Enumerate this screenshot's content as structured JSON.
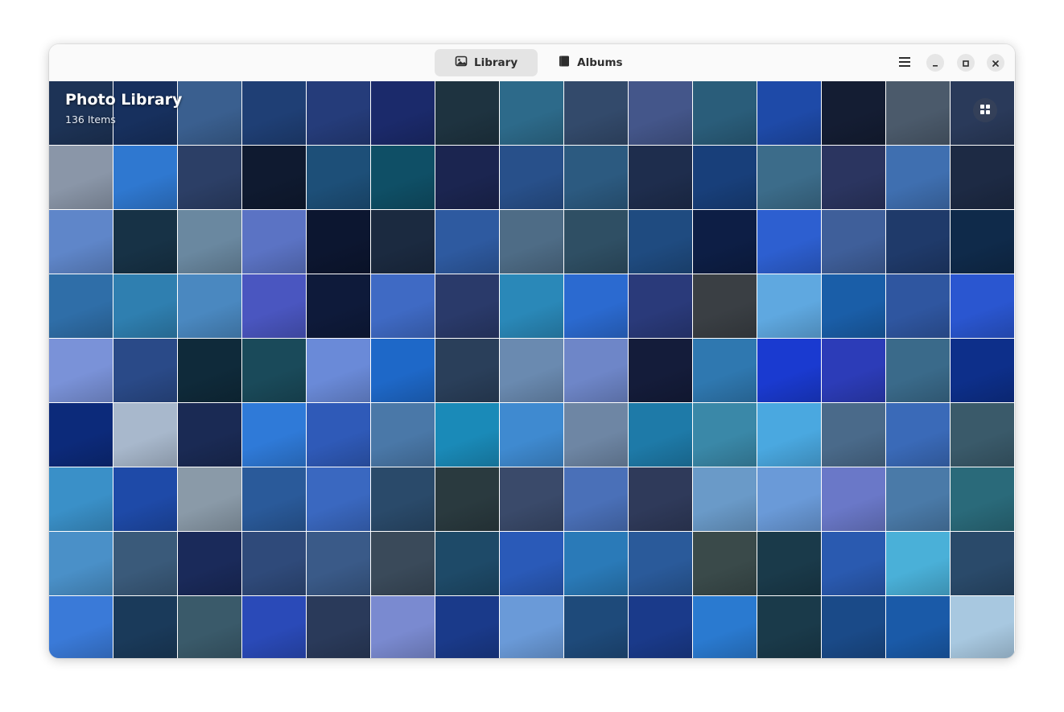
{
  "header": {
    "tabs": [
      {
        "label": "Library",
        "icon": "image-icon",
        "active": true
      },
      {
        "label": "Albums",
        "icon": "album-icon",
        "active": false
      }
    ],
    "menu_icon": "hamburger-menu-icon",
    "window_controls": [
      "minimize-icon",
      "maximize-icon",
      "close-icon"
    ]
  },
  "library": {
    "title": "Photo Library",
    "count": "136 Items",
    "view_toggle_icon": "grid-view-icon"
  },
  "photos": [
    [
      "#1d3356",
      "#17305e",
      "#3a5f8f",
      "#1f3f75",
      "#253c7a",
      "#1b2a6b",
      "#1e3340",
      "#2d6a8a",
      "#334a6b",
      "#44568a",
      "#2a5d7a",
      "#1e4aa8",
      "#141d33",
      "#4b5a6b",
      "#2a3a5a"
    ],
    [
      "#8a96a8",
      "#2f78d0",
      "#2c3f66",
      "#0f1a30",
      "#1d4f78",
      "#0f4f66",
      "#1b2550",
      "#28508a",
      "#2c5a80",
      "#1e2d4d",
      "#183f7a",
      "#3c6c8a",
      "#2b3560",
      "#3f6fb0",
      "#1d2a44"
    ],
    [
      "#5f86c9",
      "#173246",
      "#6a88a0",
      "#5b73c4",
      "#0c1630",
      "#1b2a40",
      "#2e5aa0",
      "#4e6c86",
      "#2f4f64",
      "#1f4b80",
      "#0d1e45",
      "#2d5fd0",
      "#3f5f9a",
      "#1f3a6a",
      "#0f2a4a"
    ],
    [
      "#2f6ea8",
      "#2f7fb0",
      "#4a88c0",
      "#4a56c0",
      "#0e1a3a",
      "#3f6ac4",
      "#2a3a6a",
      "#2a88b8",
      "#2b6ad0",
      "#2a3a7a",
      "#3a3f44",
      "#5fa8e0",
      "#1a5ea8",
      "#2f56a0",
      "#2a56d0"
    ],
    [
      "#7a92d8",
      "#2a4a88",
      "#0f2a3a",
      "#1a4a5a",
      "#6a8ad8",
      "#1e68c8",
      "#2a3f5a",
      "#6a8ab0",
      "#6e86c8",
      "#141c3a",
      "#2f78b0",
      "#1a3ad0",
      "#2c3cb8",
      "#3a6a8a",
      "#0d2f8a"
    ],
    [
      "#0c2a7a",
      "#a8b8cc",
      "#1a2a54",
      "#2f7ad8",
      "#2f5ab8",
      "#4a78a8",
      "#1a8ab8",
      "#3f8ad0",
      "#6e86a4",
      "#1e7aa8",
      "#3a88a8",
      "#4aa8e0",
      "#4a6a8a",
      "#3a6ab8",
      "#3a5a6a"
    ],
    [
      "#3a90c8",
      "#1e4aa8",
      "#8a9aa8",
      "#2a5a9a",
      "#3a68c0",
      "#2a4a6a",
      "#2a3a3f",
      "#3a4a6a",
      "#4a70b8",
      "#2f3a5a",
      "#6a9ac8",
      "#6a9ad8",
      "#6a78c8",
      "#4a7aa8",
      "#2a6a7a"
    ],
    [
      "#4a90c8",
      "#3a5a7a",
      "#1a2a5a",
      "#2f4a7a",
      "#3a5a88",
      "#3a4a5a",
      "#1e4a68",
      "#2a5ab8",
      "#2a7ab8",
      "#2a5a9a",
      "#3a4a4a",
      "#1a3a4a",
      "#2a5ab0",
      "#4ab0d8",
      "#2a4a6a"
    ],
    [
      "#3a7ad8",
      "#1a3a5a",
      "#3a5a6a",
      "#2a4ab8",
      "#2a3a5a",
      "#7a8ad0",
      "#1a3a8a",
      "#6a9ad8",
      "#1e4a7a",
      "#1a3a8a",
      "#2a7ad0",
      "#1a3a4a",
      "#1a4a88",
      "#1a5aa8",
      "#a8c8e0"
    ]
  ]
}
